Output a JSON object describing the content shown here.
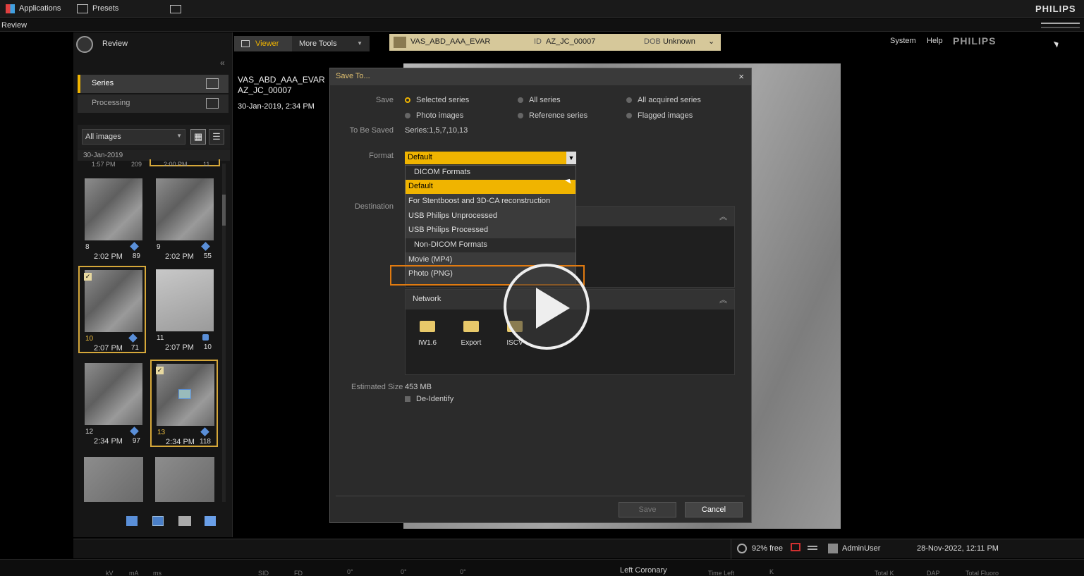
{
  "topbar": {
    "applications": "Applications",
    "presets": "Presets",
    "brand": "PHILIPS"
  },
  "review_bar": {
    "label": "Review"
  },
  "left_panel": {
    "title": "Review",
    "tabs": [
      {
        "label": "Series"
      },
      {
        "label": "Processing"
      }
    ],
    "filter_value": "All images",
    "date_group": "30-Jan-2019",
    "partial_top": {
      "left_time": "1:57 PM",
      "left_count": "209",
      "right_time": "2:00 PM",
      "right_count": "11"
    },
    "thumbs": [
      {
        "num": "8",
        "time": "2:02 PM",
        "count": "89"
      },
      {
        "num": "9",
        "time": "2:02 PM",
        "count": "55"
      },
      {
        "num": "10",
        "time": "2:07 PM",
        "count": "71"
      },
      {
        "num": "11",
        "time": "2:07 PM",
        "count": "10"
      },
      {
        "num": "12",
        "time": "2:34 PM",
        "count": "97"
      },
      {
        "num": "13",
        "time": "2:34 PM",
        "count": "118"
      }
    ]
  },
  "tabs": {
    "viewer": "Viewer",
    "more_tools": "More Tools"
  },
  "patient": {
    "name": "VAS_ABD_AAA_EVAR",
    "id_label": "ID",
    "id": "AZ_JC_00007",
    "dob_label": "DOB",
    "dob": "Unknown"
  },
  "header_right": {
    "system": "System",
    "help": "Help",
    "brand": "PHILIPS"
  },
  "study_info": {
    "name": "VAS_ABD_AAA_EVAR",
    "id": "AZ_JC_00007",
    "date": "30-Jan-2019, 2:34 PM"
  },
  "dialog": {
    "title": "Save To...",
    "save_label": "Save",
    "options": [
      "Selected series",
      "All series",
      "All acquired series",
      "Photo images",
      "Reference series",
      "Flagged images"
    ],
    "to_be_saved_label": "To Be Saved",
    "to_be_saved_value": "Series:1,5,7,10,13",
    "format_label": "Format",
    "format_value": "Default",
    "dropdown": [
      "DICOM Formats",
      "Default",
      "For Stentboost and 3D-CA reconstruction",
      "USB Philips Unprocessed",
      "USB Philips Processed",
      "Non-DICOM Formats",
      "Movie (MP4)",
      "Photo (PNG)"
    ],
    "destination_label": "Destination",
    "network_label": "Network",
    "destinations": [
      "IW1.6",
      "Export",
      "ISCV"
    ],
    "estimated_size_label": "Estimated Size",
    "estimated_size_value": "453 MB",
    "deidentify": "De-Identify",
    "save_button": "Save",
    "cancel_button": "Cancel"
  },
  "status": {
    "disk": "92% free",
    "user": "AdminUser",
    "datetime": "28-Nov-2022, 12:11 PM"
  },
  "bottom": {
    "kv": "kV",
    "ma": "mA",
    "ms": "ms",
    "sid": "SID",
    "fd": "FD",
    "angle1": "0°",
    "angle2": "0°",
    "angle3": "0°",
    "protocol": "Left Coronary",
    "time_left": "Time Left",
    "k": "K",
    "total_k": "Total K",
    "dap": "DAP",
    "total_fluoro": "Total Fluoro"
  },
  "colors": {
    "accent": "#f0b400",
    "highlight": "#e07a10",
    "patient_bar": "#d6c89a"
  }
}
